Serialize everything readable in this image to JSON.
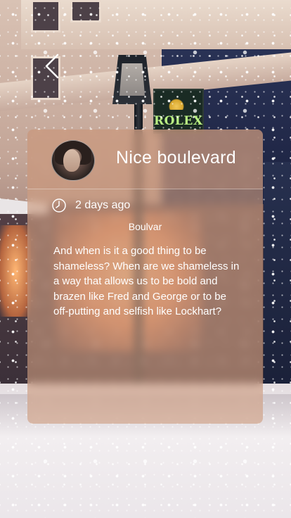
{
  "nav": {
    "back_icon": "chevron-left-icon"
  },
  "background": {
    "sign_text": "ROLEX"
  },
  "post": {
    "title": "Nice boulevard",
    "avatar_icon": "avatar",
    "timestamp_icon": "clock-icon",
    "timestamp": "2 days ago",
    "author": "Boulvar",
    "body": "And when is it a good thing to be shameless? When are we shameless in a way that allows us to be bold and brazen like Fred and George or to be off-putting and selfish like Lockhart?"
  },
  "colors": {
    "card_bg": "#CE9C80",
    "text": "#FFFFFF",
    "sign_text": "#B9F083"
  }
}
